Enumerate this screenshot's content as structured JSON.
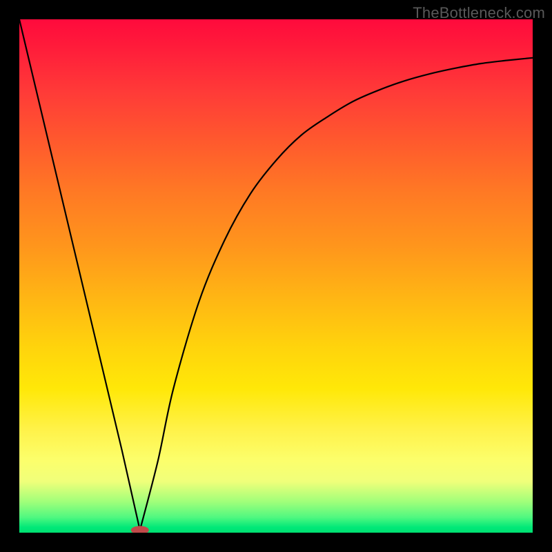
{
  "watermark": "TheBottleneck.com",
  "chart_data": {
    "type": "line",
    "title": "",
    "xlabel": "",
    "ylabel": "",
    "xlim": [
      0,
      1
    ],
    "ylim": [
      0,
      1
    ],
    "grid": false,
    "legend": false,
    "note": "Axes are unlabeled; values are normalized 0–1. Background is a vertical red→yellow→green gradient. A single black curve descends steeply from the top-left to a minimum near x≈0.24, y≈0 (marked by a small red lozenge), then rises with decreasing slope toward the upper right.",
    "series": [
      {
        "name": "curve",
        "x": [
          0.0,
          0.05,
          0.1,
          0.15,
          0.2,
          0.235,
          0.27,
          0.3,
          0.35,
          0.4,
          0.45,
          0.5,
          0.55,
          0.6,
          0.65,
          0.7,
          0.75,
          0.8,
          0.85,
          0.9,
          0.95,
          1.0
        ],
        "y": [
          1.0,
          0.79,
          0.58,
          0.37,
          0.16,
          0.005,
          0.14,
          0.28,
          0.45,
          0.57,
          0.66,
          0.725,
          0.775,
          0.81,
          0.84,
          0.862,
          0.88,
          0.894,
          0.905,
          0.914,
          0.92,
          0.925
        ]
      }
    ],
    "marker": {
      "name": "minimum-marker",
      "x": 0.235,
      "y": 0.005,
      "color": "#c14a4a",
      "shape": "lozenge"
    },
    "gradient_stops": [
      {
        "pos": 0.0,
        "color": "#ff0a3c"
      },
      {
        "pos": 0.5,
        "color": "#ffbe10"
      },
      {
        "pos": 0.82,
        "color": "#fff24a"
      },
      {
        "pos": 1.0,
        "color": "#00e070"
      }
    ]
  }
}
